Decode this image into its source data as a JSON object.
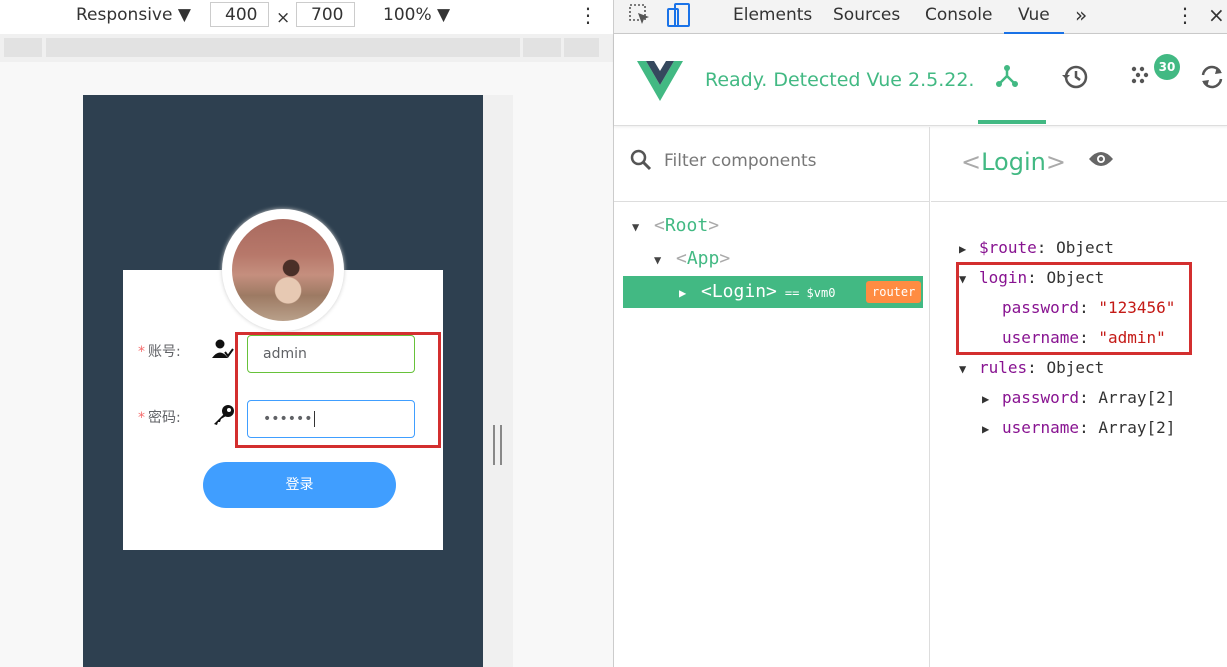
{
  "device_toolbar": {
    "mode": "Responsive",
    "width": "400",
    "times": "×",
    "height": "700",
    "zoom": "100%"
  },
  "login_form": {
    "username_label": "账号:",
    "password_label": "密码:",
    "required_mark": "*",
    "username_value": "admin",
    "password_value": "••••••",
    "submit_label": "登录"
  },
  "devtools": {
    "tabs": [
      "Elements",
      "Sources",
      "Console",
      "Vue"
    ],
    "more_tabs": "»",
    "active_tab": "Vue",
    "vue_status": "Ready. Detected Vue 2.5.22.",
    "events_count": "30",
    "filter_placeholder": "Filter components",
    "tree": {
      "root": "Root",
      "app": "App",
      "login": "Login",
      "vm": "== $vm0",
      "tag": "router"
    },
    "selected": "Login",
    "state": {
      "route_key": "$route",
      "route_type": "Object",
      "login_key": "login",
      "login_type": "Object",
      "password_key": "password",
      "password_val": "\"123456\"",
      "username_key": "username",
      "username_val": "\"admin\"",
      "rules_key": "rules",
      "rules_type": "Object",
      "rules_password_key": "password",
      "rules_password_type": "Array[2]",
      "rules_username_key": "username",
      "rules_username_type": "Array[2]"
    }
  },
  "colors": {
    "vue_green": "#42b983",
    "device_bg": "#2e4050",
    "button_blue": "#409eff",
    "highlight_red": "#d32f2f",
    "router_tag": "#ff8c42"
  }
}
